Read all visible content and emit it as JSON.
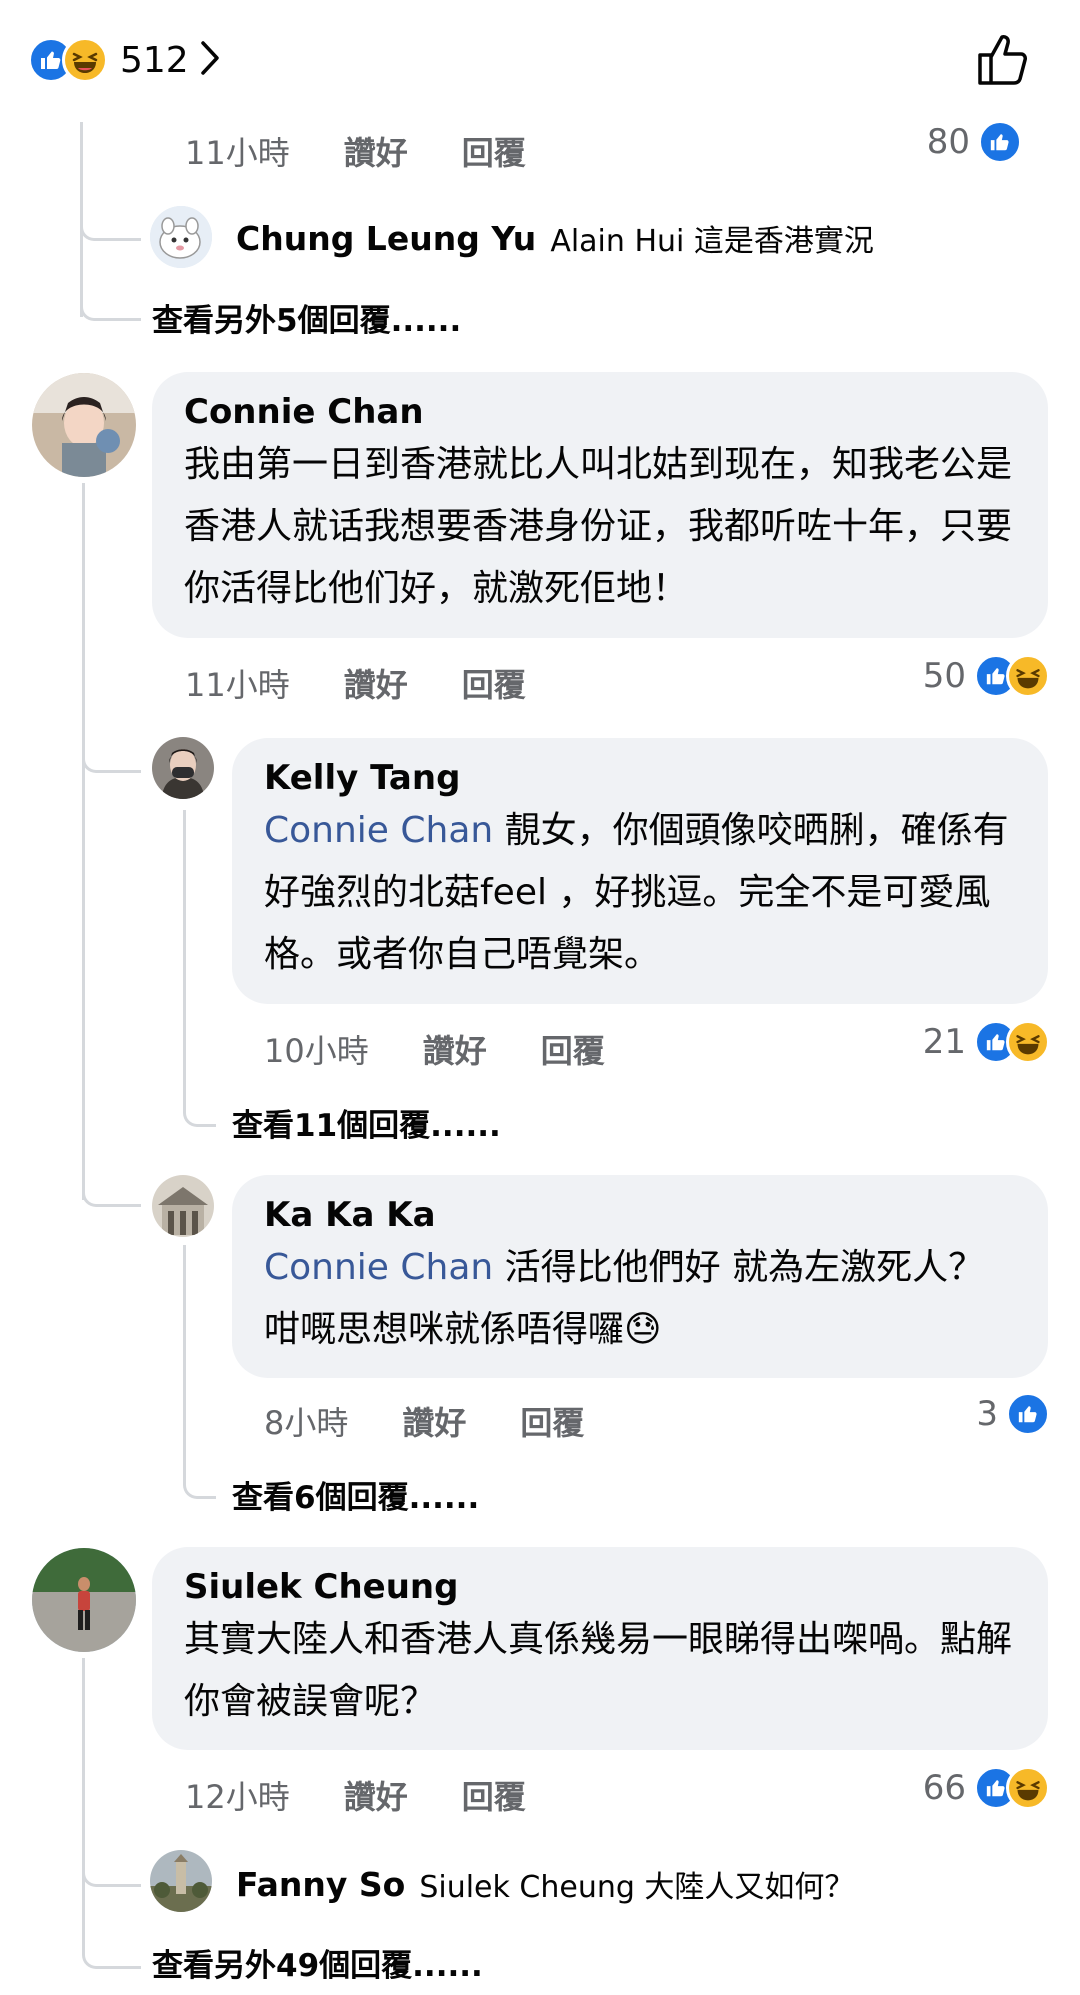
{
  "header": {
    "reaction_count": "512",
    "reaction_icons": [
      "like-icon",
      "haha-icon"
    ],
    "right_icon": "thumbs-up-outline-icon"
  },
  "top_comment_tail": {
    "time": "11小時",
    "like_label": "讚好",
    "reply_label": "回覆",
    "reactions": "80",
    "inline_reply": {
      "name": "Chung Leung Yu",
      "text": "Alain Hui 這是香港實況"
    },
    "more_replies": "查看另外5個回覆......"
  },
  "comments": [
    {
      "name": "Connie Chan",
      "text": "我由第一日到香港就比人叫北姑到现在，知我老公是香港人就话我想要香港身份证，我都听咗十年，只要你活得比他们好，就激死佢地！",
      "time": "11小時",
      "like_label": "讚好",
      "reply_label": "回覆",
      "reactions": "50",
      "replies": [
        {
          "name": "Kelly Tang",
          "mention": "Connie Chan",
          "text": " 靚女，你個頭像咬晒脷，確係有好強烈的北菇feel ，好挑逗。完全不是可愛風格。或者你自己唔覺架。",
          "time": "10小時",
          "like_label": "讚好",
          "reply_label": "回覆",
          "reactions": "21",
          "more_replies": "查看11個回覆......"
        },
        {
          "name": "Ka Ka Ka",
          "mention": "Connie Chan",
          "text": " 活得比他們好 就為左激死人？咁嘅思想咪就係唔得囉",
          "emoji": "😓",
          "time": "8小時",
          "like_label": "讚好",
          "reply_label": "回覆",
          "reactions": "3",
          "more_replies": "查看6個回覆......"
        }
      ]
    },
    {
      "name": "Siulek Cheung",
      "text": "其實大陸人和香港人真係幾易一眼睇得出㗎喎。點解你會被誤會呢？",
      "time": "12小時",
      "like_label": "讚好",
      "reply_label": "回覆",
      "reactions": "66",
      "inline_reply": {
        "name": "Fanny So",
        "text": "Siulek Cheung 大陸人又如何？"
      },
      "more_replies": "查看另外49個回覆......"
    }
  ],
  "colors": {
    "like_blue": "#1b74e4",
    "haha_yellow": "#f7b928",
    "bubble_bg": "#f0f2f5",
    "mention": "#385898",
    "meta_gray": "#65676b"
  }
}
